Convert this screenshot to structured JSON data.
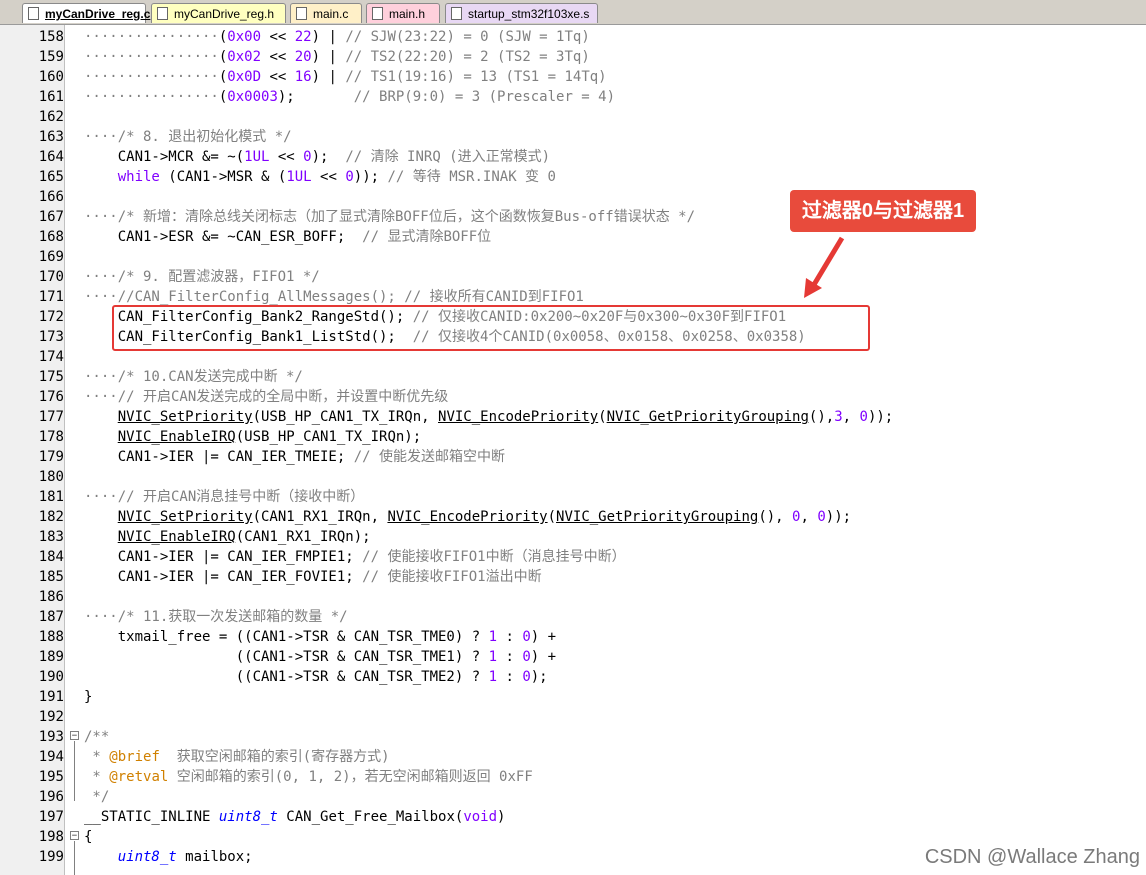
{
  "tabs": [
    {
      "label": "myCanDrive_reg.c",
      "color": "#ffffff",
      "active": true
    },
    {
      "label": "myCanDrive_reg.h",
      "color": "#ffffc0",
      "active": false
    },
    {
      "label": "main.c",
      "color": "#fff0c8",
      "active": false
    },
    {
      "label": "main.h",
      "color": "#ffd0dc",
      "active": false
    },
    {
      "label": "startup_stm32f103xe.s",
      "color": "#e8d8f4",
      "active": false
    }
  ],
  "lines": [
    {
      "n": "158",
      "html": "<span class=\"cm\">················</span>(<span class=\"num\">0x00</span> << <span class=\"num\">22</span>) | <span class=\"cm\">// SJW(23:22) = 0 (SJW = 1Tq)</span>"
    },
    {
      "n": "159",
      "html": "<span class=\"cm\">················</span>(<span class=\"num\">0x02</span> << <span class=\"num\">20</span>) | <span class=\"cm\">// TS2(22:20) = 2 (TS2 = 3Tq)</span>"
    },
    {
      "n": "160",
      "html": "<span class=\"cm\">················</span>(<span class=\"num\">0x0D</span> << <span class=\"num\">16</span>) | <span class=\"cm\">// TS1(19:16) = 13 (TS1 = 14Tq)</span>"
    },
    {
      "n": "161",
      "html": "<span class=\"cm\">················</span>(<span class=\"num\">0x0003</span>);       <span class=\"cm\">// BRP(9:0) = 3 (Prescaler = 4)</span>"
    },
    {
      "n": "162",
      "html": ""
    },
    {
      "n": "163",
      "html": "<span class=\"cm\">····/* 8. 退出初始化模式 */</span>"
    },
    {
      "n": "164",
      "html": "    CAN1->MCR &= ~(<span class=\"num\">1UL</span> << <span class=\"num\">0</span>);  <span class=\"cm\">// 清除 INRQ (进入正常模式)</span>"
    },
    {
      "n": "165",
      "html": "    <span class=\"kw\">while</span> (CAN1->MSR & (<span class=\"num\">1UL</span> << <span class=\"num\">0</span>)); <span class=\"cm\">// 等待 MSR.INAK 变 0</span>"
    },
    {
      "n": "166",
      "html": ""
    },
    {
      "n": "167",
      "html": "<span class=\"cm\">····/* 新增：清除总线关闭标志（加了显式清除BOFF位后，这个函数恢复Bus-off错误状态 */</span>"
    },
    {
      "n": "168",
      "html": "    CAN1->ESR &= ~CAN_ESR_BOFF;  <span class=\"cm\">// 显式清除BOFF位</span>"
    },
    {
      "n": "169",
      "html": ""
    },
    {
      "n": "170",
      "html": "<span class=\"cm\">····/* 9. 配置滤波器，FIFO1 */</span>"
    },
    {
      "n": "171",
      "html": "<span class=\"cm\">····//CAN_FilterConfig_AllMessages(); // 接收所有CANID到FIFO1</span>"
    },
    {
      "n": "172",
      "html": "    CAN_FilterConfig_Bank2_RangeStd(); <span class=\"cm\">// 仅接收CANID:0x200~0x20F与0x300~0x30F到FIFO1</span>"
    },
    {
      "n": "173",
      "html": "    CAN_FilterConfig_Bank1_ListStd();  <span class=\"cm\">// 仅接收4个CANID(0x0058、0x0158、0x0258、0x0358)</span>"
    },
    {
      "n": "174",
      "html": ""
    },
    {
      "n": "175",
      "html": "<span class=\"cm\">····/* 10.CAN发送完成中断 */</span>"
    },
    {
      "n": "176",
      "html": "<span class=\"cm\">····// 开启CAN发送完成的全局中断，并设置中断优先级</span>"
    },
    {
      "n": "177",
      "html": "    <span class=\"fn\">NVIC_SetPriority</span>(USB_HP_CAN1_TX_IRQn, <span class=\"fn\">NVIC_EncodePriority</span>(<span class=\"fn\">NVIC_GetPriorityGrouping</span>(),<span class=\"num\">3</span>, <span class=\"num\">0</span>));"
    },
    {
      "n": "178",
      "html": "    <span class=\"fn\">NVIC_EnableIRQ</span>(USB_HP_CAN1_TX_IRQn);"
    },
    {
      "n": "179",
      "html": "    CAN1->IER |= CAN_IER_TMEIE; <span class=\"cm\">// 使能发送邮箱空中断</span>"
    },
    {
      "n": "180",
      "html": ""
    },
    {
      "n": "181",
      "html": "<span class=\"cm\">····// 开启CAN消息挂号中断（接收中断）</span>"
    },
    {
      "n": "182",
      "html": "    <span class=\"fn\">NVIC_SetPriority</span>(CAN1_RX1_IRQn, <span class=\"fn\">NVIC_EncodePriority</span>(<span class=\"fn\">NVIC_GetPriorityGrouping</span>(), <span class=\"num\">0</span>, <span class=\"num\">0</span>));"
    },
    {
      "n": "183",
      "html": "    <span class=\"fn\">NVIC_EnableIRQ</span>(CAN1_RX1_IRQn);"
    },
    {
      "n": "184",
      "html": "    CAN1->IER |= CAN_IER_FMPIE1; <span class=\"cm\">// 使能接收FIFO1中断（消息挂号中断）</span>"
    },
    {
      "n": "185",
      "html": "    CAN1->IER |= CAN_IER_FOVIE1; <span class=\"cm\">// 使能接收FIFO1溢出中断</span>"
    },
    {
      "n": "186",
      "html": ""
    },
    {
      "n": "187",
      "html": "<span class=\"cm\">····/* 11.获取一次发送邮箱的数量 */</span>"
    },
    {
      "n": "188",
      "html": "    txmail_free = ((CAN1->TSR & CAN_TSR_TME0) ? <span class=\"num\">1</span> : <span class=\"num\">0</span>) +"
    },
    {
      "n": "189",
      "html": "                  ((CAN1->TSR & CAN_TSR_TME1) ? <span class=\"num\">1</span> : <span class=\"num\">0</span>) +"
    },
    {
      "n": "190",
      "html": "                  ((CAN1->TSR & CAN_TSR_TME2) ? <span class=\"num\">1</span> : <span class=\"num\">0</span>);"
    },
    {
      "n": "191",
      "html": "}"
    },
    {
      "n": "192",
      "html": ""
    },
    {
      "n": "193",
      "html": "<span class=\"cm\">/**</span>"
    },
    {
      "n": "194",
      "html": "<span class=\"cm\"> * <span class=\"at\">@brief</span>  获取空闲邮箱的索引(寄存器方式)</span>"
    },
    {
      "n": "195",
      "html": "<span class=\"cm\"> * <span class=\"at\">@retval</span> 空闲邮箱的索引(0, 1, 2)，若无空闲邮箱则返回 0xFF</span>"
    },
    {
      "n": "196",
      "html": "<span class=\"cm\"> */</span>"
    },
    {
      "n": "197",
      "html": "__STATIC_INLINE <span class=\"ty\">uint8_t</span> CAN_Get_Free_Mailbox(<span class=\"kw\">void</span>)"
    },
    {
      "n": "198",
      "html": "{"
    },
    {
      "n": "199",
      "html": "    <span class=\"ty\">uint8_t</span> mailbox;"
    }
  ],
  "callout": {
    "label": "过滤器0与过滤器1",
    "color": "#e84b3c"
  },
  "watermark": "CSDN @Wallace Zhang",
  "highlight_color": "#e53935"
}
